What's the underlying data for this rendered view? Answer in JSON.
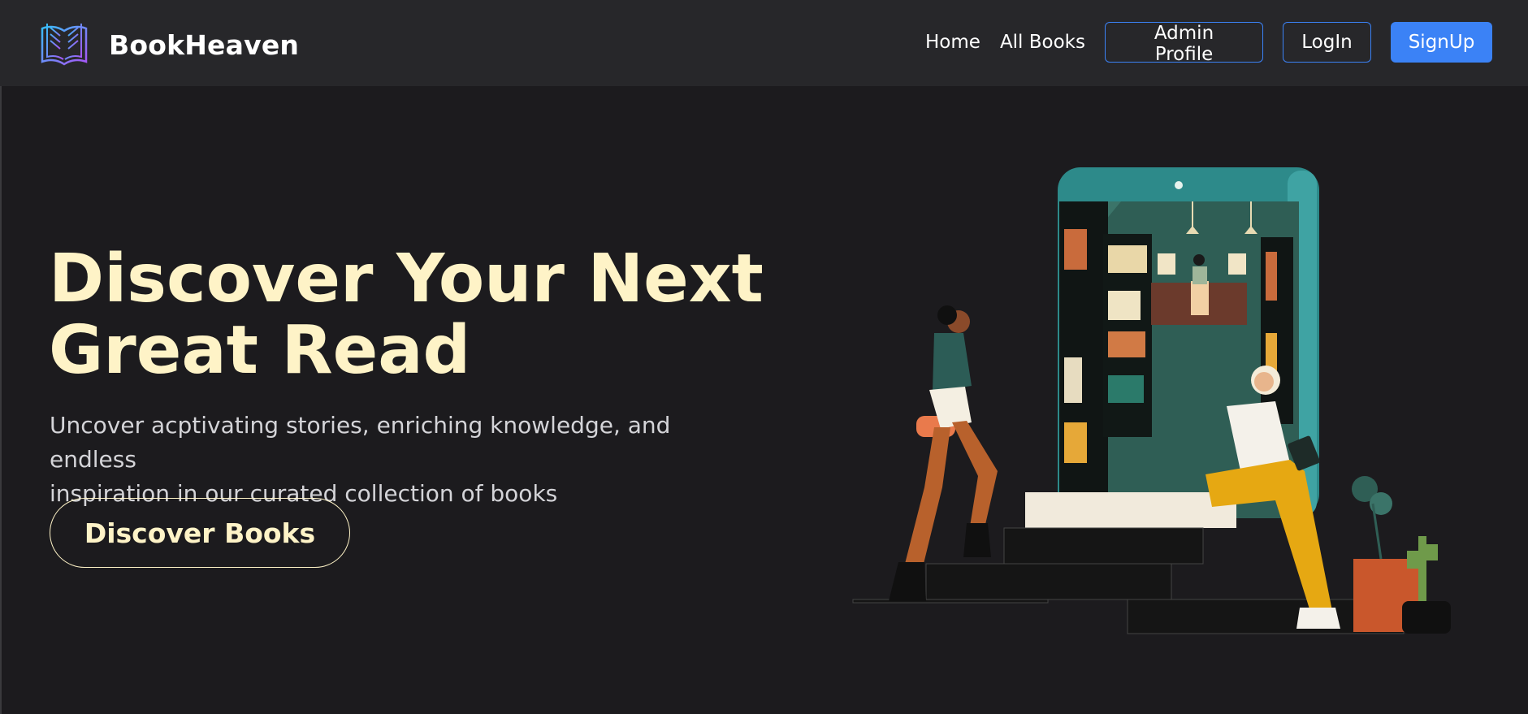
{
  "brand": {
    "name": "BookHeaven",
    "icon": "open-book-icon"
  },
  "nav": {
    "home": "Home",
    "all_books": "All Books",
    "admin_profile": "Admin Profile",
    "login": "LogIn",
    "signup": "SignUp"
  },
  "hero": {
    "title_line1": "Discover Your Next",
    "title_line2": "Great Read",
    "subtitle_line1": "Uncover acptivating stories, enriching knowledge, and endless",
    "subtitle_line2": "inspiration in our curated collection of books",
    "cta": "Discover Books"
  },
  "colors": {
    "accent": "#3b82f6",
    "hero_text": "#fef3c7",
    "navbar_bg": "#27272a",
    "page_bg": "#1c1b1e"
  }
}
